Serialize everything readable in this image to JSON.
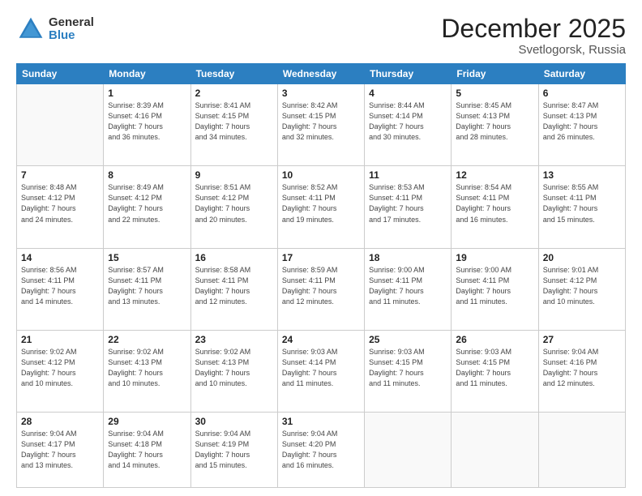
{
  "logo": {
    "general": "General",
    "blue": "Blue"
  },
  "title": "December 2025",
  "subtitle": "Svetlogorsk, Russia",
  "days_header": [
    "Sunday",
    "Monday",
    "Tuesday",
    "Wednesday",
    "Thursday",
    "Friday",
    "Saturday"
  ],
  "weeks": [
    [
      {
        "num": "",
        "detail": ""
      },
      {
        "num": "1",
        "detail": "Sunrise: 8:39 AM\nSunset: 4:16 PM\nDaylight: 7 hours\nand 36 minutes."
      },
      {
        "num": "2",
        "detail": "Sunrise: 8:41 AM\nSunset: 4:15 PM\nDaylight: 7 hours\nand 34 minutes."
      },
      {
        "num": "3",
        "detail": "Sunrise: 8:42 AM\nSunset: 4:15 PM\nDaylight: 7 hours\nand 32 minutes."
      },
      {
        "num": "4",
        "detail": "Sunrise: 8:44 AM\nSunset: 4:14 PM\nDaylight: 7 hours\nand 30 minutes."
      },
      {
        "num": "5",
        "detail": "Sunrise: 8:45 AM\nSunset: 4:13 PM\nDaylight: 7 hours\nand 28 minutes."
      },
      {
        "num": "6",
        "detail": "Sunrise: 8:47 AM\nSunset: 4:13 PM\nDaylight: 7 hours\nand 26 minutes."
      }
    ],
    [
      {
        "num": "7",
        "detail": "Sunrise: 8:48 AM\nSunset: 4:12 PM\nDaylight: 7 hours\nand 24 minutes."
      },
      {
        "num": "8",
        "detail": "Sunrise: 8:49 AM\nSunset: 4:12 PM\nDaylight: 7 hours\nand 22 minutes."
      },
      {
        "num": "9",
        "detail": "Sunrise: 8:51 AM\nSunset: 4:12 PM\nDaylight: 7 hours\nand 20 minutes."
      },
      {
        "num": "10",
        "detail": "Sunrise: 8:52 AM\nSunset: 4:11 PM\nDaylight: 7 hours\nand 19 minutes."
      },
      {
        "num": "11",
        "detail": "Sunrise: 8:53 AM\nSunset: 4:11 PM\nDaylight: 7 hours\nand 17 minutes."
      },
      {
        "num": "12",
        "detail": "Sunrise: 8:54 AM\nSunset: 4:11 PM\nDaylight: 7 hours\nand 16 minutes."
      },
      {
        "num": "13",
        "detail": "Sunrise: 8:55 AM\nSunset: 4:11 PM\nDaylight: 7 hours\nand 15 minutes."
      }
    ],
    [
      {
        "num": "14",
        "detail": "Sunrise: 8:56 AM\nSunset: 4:11 PM\nDaylight: 7 hours\nand 14 minutes."
      },
      {
        "num": "15",
        "detail": "Sunrise: 8:57 AM\nSunset: 4:11 PM\nDaylight: 7 hours\nand 13 minutes."
      },
      {
        "num": "16",
        "detail": "Sunrise: 8:58 AM\nSunset: 4:11 PM\nDaylight: 7 hours\nand 12 minutes."
      },
      {
        "num": "17",
        "detail": "Sunrise: 8:59 AM\nSunset: 4:11 PM\nDaylight: 7 hours\nand 12 minutes."
      },
      {
        "num": "18",
        "detail": "Sunrise: 9:00 AM\nSunset: 4:11 PM\nDaylight: 7 hours\nand 11 minutes."
      },
      {
        "num": "19",
        "detail": "Sunrise: 9:00 AM\nSunset: 4:11 PM\nDaylight: 7 hours\nand 11 minutes."
      },
      {
        "num": "20",
        "detail": "Sunrise: 9:01 AM\nSunset: 4:12 PM\nDaylight: 7 hours\nand 10 minutes."
      }
    ],
    [
      {
        "num": "21",
        "detail": "Sunrise: 9:02 AM\nSunset: 4:12 PM\nDaylight: 7 hours\nand 10 minutes."
      },
      {
        "num": "22",
        "detail": "Sunrise: 9:02 AM\nSunset: 4:13 PM\nDaylight: 7 hours\nand 10 minutes."
      },
      {
        "num": "23",
        "detail": "Sunrise: 9:02 AM\nSunset: 4:13 PM\nDaylight: 7 hours\nand 10 minutes."
      },
      {
        "num": "24",
        "detail": "Sunrise: 9:03 AM\nSunset: 4:14 PM\nDaylight: 7 hours\nand 11 minutes."
      },
      {
        "num": "25",
        "detail": "Sunrise: 9:03 AM\nSunset: 4:15 PM\nDaylight: 7 hours\nand 11 minutes."
      },
      {
        "num": "26",
        "detail": "Sunrise: 9:03 AM\nSunset: 4:15 PM\nDaylight: 7 hours\nand 11 minutes."
      },
      {
        "num": "27",
        "detail": "Sunrise: 9:04 AM\nSunset: 4:16 PM\nDaylight: 7 hours\nand 12 minutes."
      }
    ],
    [
      {
        "num": "28",
        "detail": "Sunrise: 9:04 AM\nSunset: 4:17 PM\nDaylight: 7 hours\nand 13 minutes."
      },
      {
        "num": "29",
        "detail": "Sunrise: 9:04 AM\nSunset: 4:18 PM\nDaylight: 7 hours\nand 14 minutes."
      },
      {
        "num": "30",
        "detail": "Sunrise: 9:04 AM\nSunset: 4:19 PM\nDaylight: 7 hours\nand 15 minutes."
      },
      {
        "num": "31",
        "detail": "Sunrise: 9:04 AM\nSunset: 4:20 PM\nDaylight: 7 hours\nand 16 minutes."
      },
      {
        "num": "",
        "detail": ""
      },
      {
        "num": "",
        "detail": ""
      },
      {
        "num": "",
        "detail": ""
      }
    ]
  ]
}
